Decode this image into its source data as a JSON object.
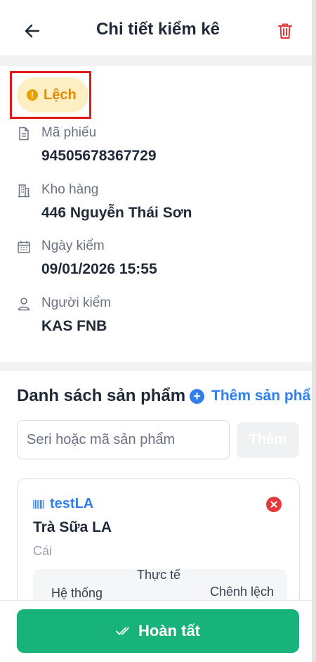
{
  "header": {
    "title": "Chi tiết kiểm kê",
    "back_icon": "arrow-left-icon",
    "delete_icon": "trash-icon"
  },
  "status": {
    "label": "Lệch",
    "icon": "alert-circle-icon",
    "color": "#e08a00",
    "background": "#fdefc3",
    "highlight_color": "#e21818"
  },
  "info": [
    {
      "icon": "document-icon",
      "label": "Mã phiếu",
      "value": "94505678367729"
    },
    {
      "icon": "building-icon",
      "label": "Kho hàng",
      "value": "446 Nguyễn Thái Sơn"
    },
    {
      "icon": "calendar-icon",
      "label": "Ngày kiểm",
      "value": "09/01/2026 15:55"
    },
    {
      "icon": "user-icon",
      "label": "Người kiểm",
      "value": "KAS FNB"
    }
  ],
  "products": {
    "title": "Danh sách sản phẩm",
    "add_label": "Thêm sản phẩ",
    "search_placeholder": "Seri hoặc mã sản phẩm",
    "search_value": "",
    "add_button": "Thêm",
    "items": [
      {
        "code": "testLA",
        "name": "Trà Sữa LA",
        "unit": "Cái",
        "columns": [
          "Hệ thống",
          "Thực tế",
          "Chênh lệch"
        ]
      }
    ]
  },
  "footer": {
    "complete_label": "Hoàn tất",
    "complete_icon": "double-check-icon",
    "accent": "#17b37b"
  },
  "colors": {
    "primary": "#2f80ed",
    "danger": "#e53939"
  }
}
